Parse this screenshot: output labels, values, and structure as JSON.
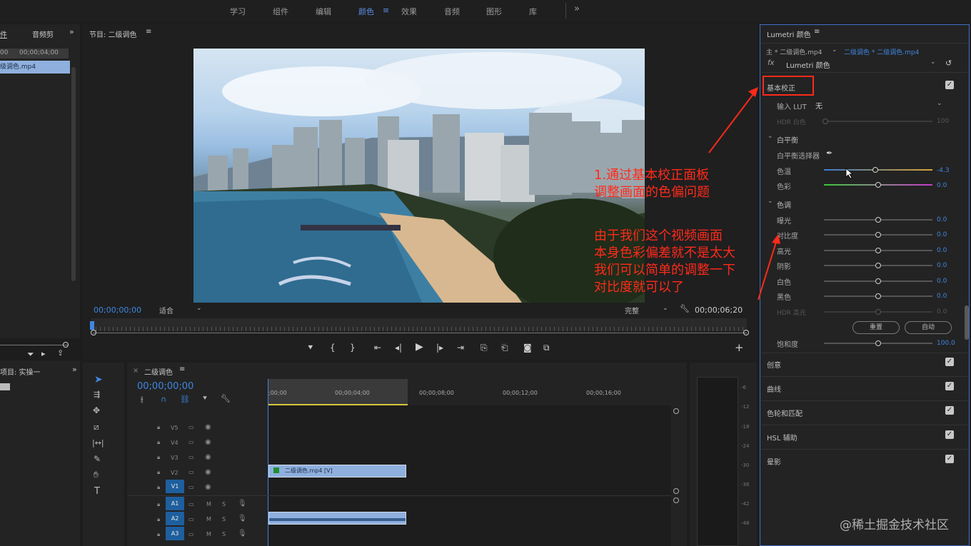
{
  "workspaces": [
    "学习",
    "组件",
    "编辑",
    "颜色",
    "效果",
    "音频",
    "图形",
    "库"
  ],
  "active_workspace": "颜色",
  "more_label": "»",
  "project_panel": {
    "tab1": "件",
    "tab2": "音频剪",
    "time1": "00",
    "time2": "00;00;04;00",
    "clip": "级调色.mp4"
  },
  "project_bottom": {
    "label": "项目: 实操一"
  },
  "program": {
    "title": "节目: 二级调色",
    "timecode": "00;00;00;00",
    "fit": "适合",
    "quality": "完整",
    "duration": "00;00;06;20"
  },
  "timeline": {
    "title": "二级调色",
    "timecode": "00;00;00;00",
    "ticks": [
      ";00;00",
      "00;00;04;00",
      "00;00;08;00",
      "00;00;12;00",
      "00;00;16;00"
    ],
    "video_tracks": [
      "V5",
      "V4",
      "V3",
      "V2",
      "V1"
    ],
    "audio_tracks": [
      "A1",
      "A2",
      "A3"
    ],
    "clip_label": "二级调色.mp4 [V]",
    "m": "M",
    "s": "S"
  },
  "meter_ticks": [
    "-6",
    "-12",
    "-18",
    "-24",
    "-30",
    "-36",
    "-42",
    "-48"
  ],
  "lumetri": {
    "title": "Lumetri 颜色",
    "source_main": "主 * 二级调色.mp4",
    "source_seq": "二级调色 * 二级调色.mp4",
    "fx": "fx",
    "effect": "Lumetri 颜色",
    "basic": "基本校正",
    "input_lut": "输入 LUT",
    "lut_value": "无",
    "hdr_white": "HDR 白色",
    "hdr_white_val": "100",
    "white_balance": "白平衡",
    "wb_selector": "白平衡选择器",
    "temp": "色温",
    "temp_val": "-4.3",
    "tint": "色彩",
    "tint_val": "0.0",
    "tone": "色调",
    "rows": [
      {
        "label": "曝光",
        "value": "0.0"
      },
      {
        "label": "对比度",
        "value": "0.0"
      },
      {
        "label": "高光",
        "value": "0.0"
      },
      {
        "label": "阴影",
        "value": "0.0"
      },
      {
        "label": "白色",
        "value": "0.0"
      },
      {
        "label": "黑色",
        "value": "0.0"
      },
      {
        "label": "HDR 高光",
        "value": "0.0"
      }
    ],
    "reset": "重置",
    "auto": "自动",
    "saturation": "饱和度",
    "saturation_val": "100.0",
    "sections": [
      "创意",
      "曲线",
      "色轮和匹配",
      "HSL 辅助",
      "晕影"
    ]
  },
  "annotations": {
    "a1_line1": "1.通过基本校正面板",
    "a1_line2": "调整画面的色偏问题",
    "a2_line1": "由于我们这个视频画面",
    "a2_line2": "本身色彩偏差就不是太大",
    "a2_line3": "我们可以简单的调整一下",
    "a2_line4": "对比度就可以了"
  },
  "watermark": "@稀土掘金技术社区",
  "colors": {
    "accent": "#3f86e0",
    "annotation": "#ff2a1a"
  }
}
